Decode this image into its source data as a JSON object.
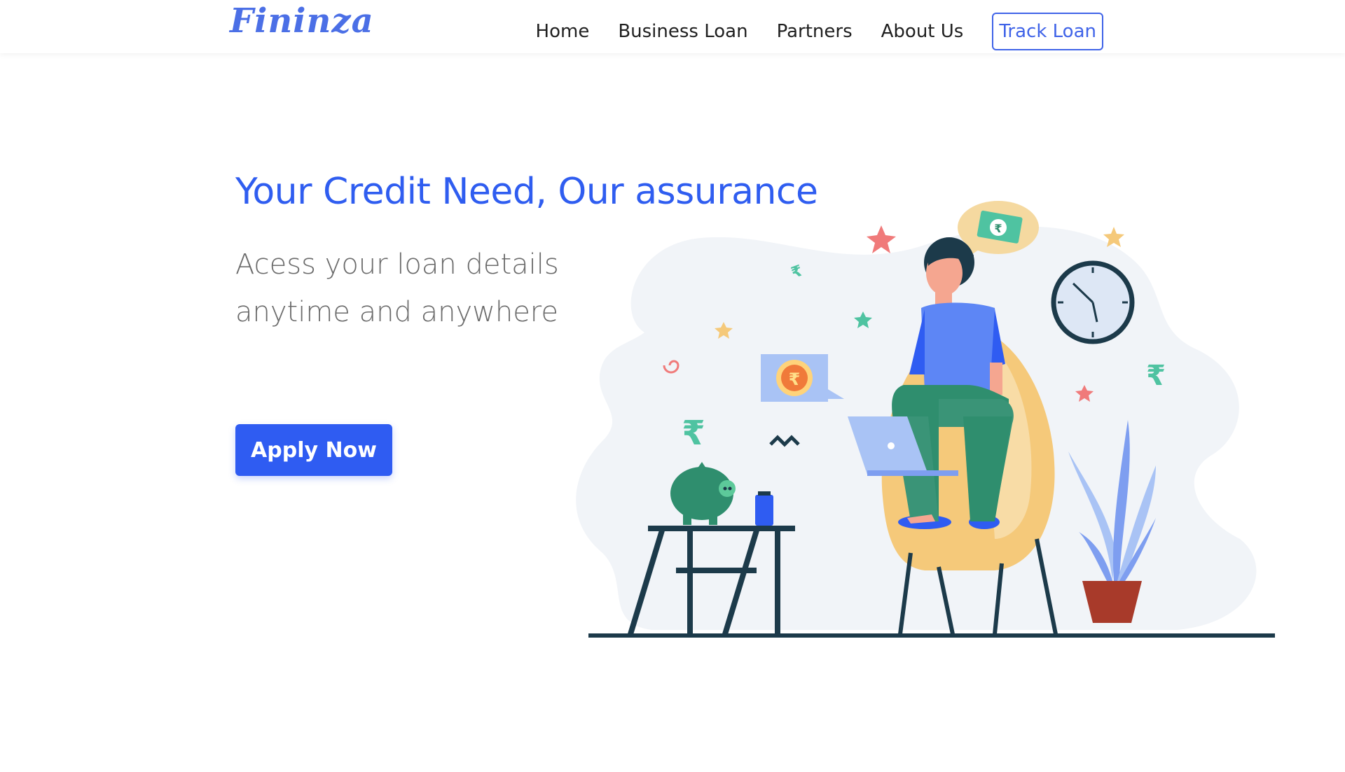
{
  "header": {
    "logo_text": "Fininza",
    "nav": [
      {
        "label": "Home"
      },
      {
        "label": "Business Loan"
      },
      {
        "label": "Partners"
      },
      {
        "label": "About Us"
      }
    ],
    "track_label": "Track Loan"
  },
  "hero": {
    "title": "Your Credit Need, Our assurance",
    "subtitle_line1": "Acess your loan details",
    "subtitle_line2": "anytime and anywhere",
    "apply_label": "Apply Now"
  },
  "illustration": {
    "currency_symbol": "₹"
  },
  "colors": {
    "primary": "#2f5cf2",
    "title": "#2f5df0",
    "text_dark": "#1f1f1f",
    "text_muted": "#6b6b6b",
    "ink": "#1c3a4a",
    "green": "#3a8b6f",
    "teal": "#4fc3a1",
    "yellow": "#f5c97a",
    "blob": "#f1f4f8",
    "pink_star": "#f07a7a"
  }
}
